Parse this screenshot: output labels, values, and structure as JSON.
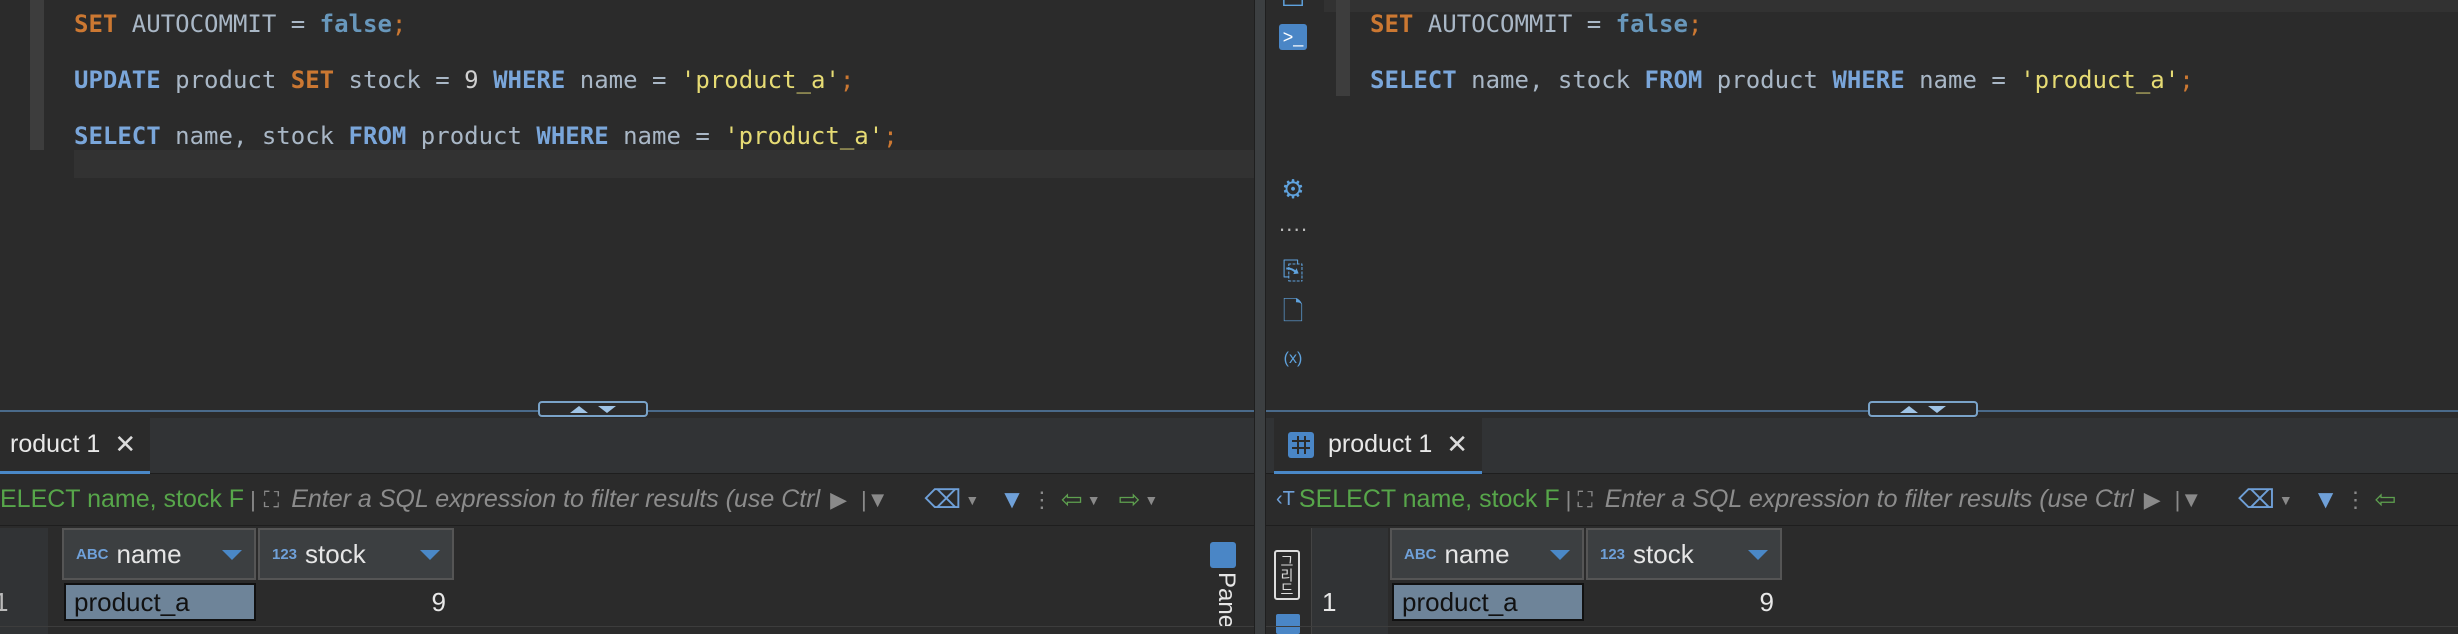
{
  "left_pane": {
    "code_lines": [
      {
        "tokens": [
          [
            "kw",
            "SET"
          ],
          [
            "ident",
            " AUTOCOMMIT = "
          ],
          [
            "kw2",
            "false"
          ],
          [
            "punc",
            ";"
          ]
        ]
      },
      {
        "tokens": [
          [
            "kwb",
            "UPDATE"
          ],
          [
            "ident",
            " product "
          ],
          [
            "kw",
            "SET"
          ],
          [
            "ident",
            " stock = "
          ],
          [
            "num",
            "9"
          ],
          [
            "ident",
            " "
          ],
          [
            "kwb",
            "WHERE"
          ],
          [
            "ident",
            " name = "
          ],
          [
            "str",
            "'product_a'"
          ],
          [
            "punc",
            ";"
          ]
        ]
      },
      {
        "tokens": [
          [
            "kwb",
            "SELECT"
          ],
          [
            "ident",
            " name, stock "
          ],
          [
            "kwb",
            "FROM"
          ],
          [
            "ident",
            " product "
          ],
          [
            "kwb",
            "WHERE"
          ],
          [
            "ident",
            " name = "
          ],
          [
            "str",
            "'product_a'"
          ],
          [
            "punc",
            ";"
          ]
        ]
      }
    ],
    "tab_label": "roduct 1",
    "tab_close": "✕",
    "query_text": "ELECT name, stock F",
    "filter_placeholder": "Enter a SQL expression to filter results (use Ctrl",
    "columns": [
      {
        "type": "ABC",
        "name": "name"
      },
      {
        "type": "123",
        "name": "stock"
      }
    ],
    "row": {
      "num": "1",
      "name": "product_a",
      "stock": "9"
    },
    "side_panel_label": "Pane"
  },
  "right_pane": {
    "code_lines": [
      {
        "tokens": [
          [
            "kw",
            "SET"
          ],
          [
            "ident",
            " AUTOCOMMIT = "
          ],
          [
            "kw2",
            "false"
          ],
          [
            "punc",
            ";"
          ]
        ]
      },
      {
        "tokens": [
          [
            "kwb",
            "SELECT"
          ],
          [
            "ident",
            " name, stock "
          ],
          [
            "kwb",
            "FROM"
          ],
          [
            "ident",
            " product "
          ],
          [
            "kwb",
            "WHERE"
          ],
          [
            "ident",
            " name = "
          ],
          [
            "str",
            "'product_a'"
          ],
          [
            "punc",
            ";"
          ]
        ]
      }
    ],
    "tab_label": "product 1",
    "tab_close": "✕",
    "query_text": "SELECT name, stock F",
    "query_prefix": "‹T",
    "filter_placeholder": "Enter a SQL expression to filter results (use Ctrl",
    "columns": [
      {
        "type": "ABC",
        "name": "name"
      },
      {
        "type": "123",
        "name": "stock"
      }
    ],
    "row": {
      "num": "1",
      "name": "product_a",
      "stock": "9"
    },
    "side_label": "그리드"
  },
  "icons": {
    "execute": "terminal-icon",
    "settings": "gear-icon",
    "more": "more-dots-icon",
    "export": "export-icon",
    "error_log": "file-error-icon",
    "variables": "variables-icon",
    "expand": "expand-icon",
    "eraser": "eraser-icon",
    "filter": "filter-icon",
    "back": "back-arrow-icon",
    "forward": "forward-arrow-icon"
  },
  "colors": {
    "keyword_orange": "#cc7832",
    "keyword_blue": "#7aa6da",
    "string_yellow": "#e6db74",
    "query_green": "#57a64a",
    "accent_blue": "#4a88c7"
  }
}
